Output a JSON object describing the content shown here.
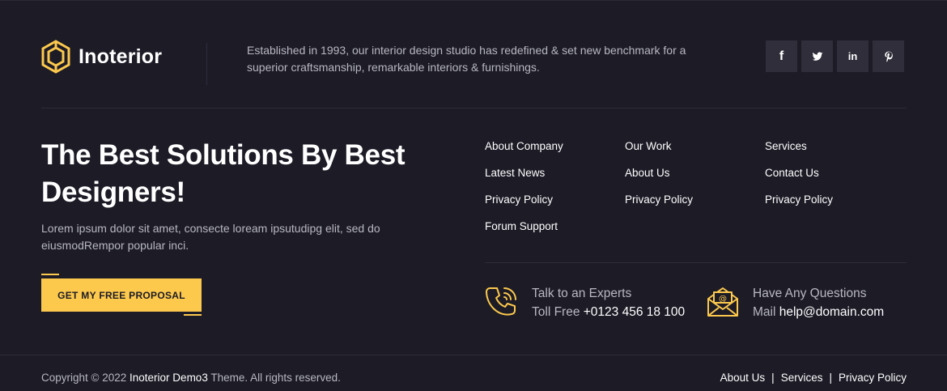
{
  "brand": {
    "name": "Inoterior",
    "accent_color": "#fdc94d",
    "logo_icon": "hexagon-logo-icon"
  },
  "about": {
    "text": "Established in 1993, our interior design studio has redefined & set new benchmark for a superior craftsmanship, remarkable interiors & furnishings."
  },
  "social": [
    {
      "icon": "facebook-icon",
      "glyph": "f"
    },
    {
      "icon": "twitter-icon"
    },
    {
      "icon": "linkedin-icon",
      "glyph": "in"
    },
    {
      "icon": "pinterest-icon"
    }
  ],
  "hero": {
    "headline": "The Best Solutions By Best Designers!",
    "description": "Lorem ipsum dolor sit amet, consecte loream ipsutudipg elit, sed do eiusmodRempor popular inci.",
    "cta_label": "GET MY FREE PROPOSAL"
  },
  "links": {
    "col1": [
      "About Company",
      "Latest News",
      "Privacy Policy",
      "Forum Support"
    ],
    "col2": [
      "Our Work",
      "About Us",
      "Privacy Policy"
    ],
    "col3": [
      "Services",
      "Contact Us",
      "Privacy Policy"
    ]
  },
  "contact": {
    "phone": {
      "title": "Talk to an Experts",
      "prefix": "Toll Free",
      "value": "+0123 456 18 100",
      "icon": "phone-icon"
    },
    "email": {
      "title": "Have Any Questions",
      "prefix": "Mail",
      "value": "help@domain.com",
      "icon": "mail-icon"
    }
  },
  "footer": {
    "copyright_pre": "Copyright © 2022",
    "copyright_brand": "Inoterior Demo3",
    "copyright_post": "Theme. All rights reserved.",
    "links": [
      "About Us",
      "Services",
      "Privacy Policy"
    ],
    "separator": "|"
  }
}
